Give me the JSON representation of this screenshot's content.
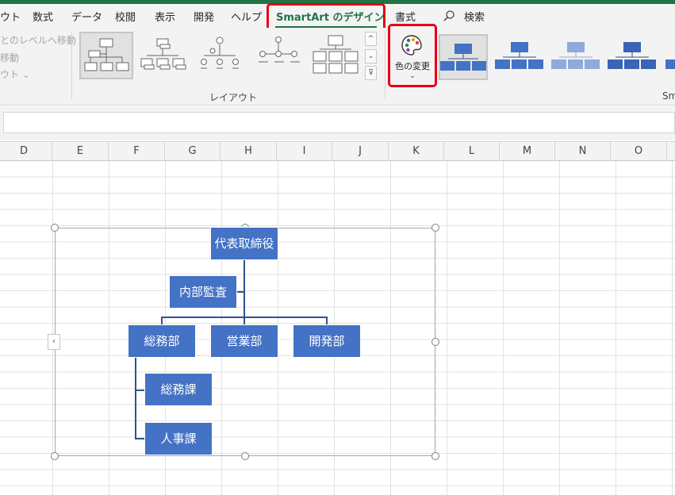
{
  "ribbon_tabs": {
    "layout_partial": "ウト",
    "formulas": "数式",
    "data": "データ",
    "review": "校閲",
    "view": "表示",
    "developer": "開発",
    "help": "ヘルプ",
    "smartart_design": "SmartArt のデザイン",
    "format": "書式",
    "search": "検索"
  },
  "ribbon_left": {
    "move_to_upper_level": "とのレベルへ移動",
    "move": "移動",
    "layout_dropdown": "ウト ⌄"
  },
  "ribbon_groups": {
    "layout_label": "レイアウト",
    "smartart_styles_label_partial": "Sm"
  },
  "color_button": {
    "label": "色の変更",
    "chevron": "⌄"
  },
  "gallery_buttons": {
    "up": "^",
    "down": "⌄",
    "more": "⊽"
  },
  "column_headers": [
    "D",
    "E",
    "F",
    "G",
    "H",
    "I",
    "J",
    "K",
    "L",
    "M",
    "N",
    "O"
  ],
  "collapse_tab": "‹",
  "org_chart": {
    "top": "代表取締役",
    "assistant": "内部監査",
    "departments": [
      "総務部",
      "営業部",
      "開発部"
    ],
    "sub_units": [
      "総務課",
      "人事課"
    ]
  },
  "colors": {
    "excel_green": "#217346",
    "node_fill": "#4472c4",
    "connector": "#2f528f",
    "highlight_red": "#e60012"
  }
}
